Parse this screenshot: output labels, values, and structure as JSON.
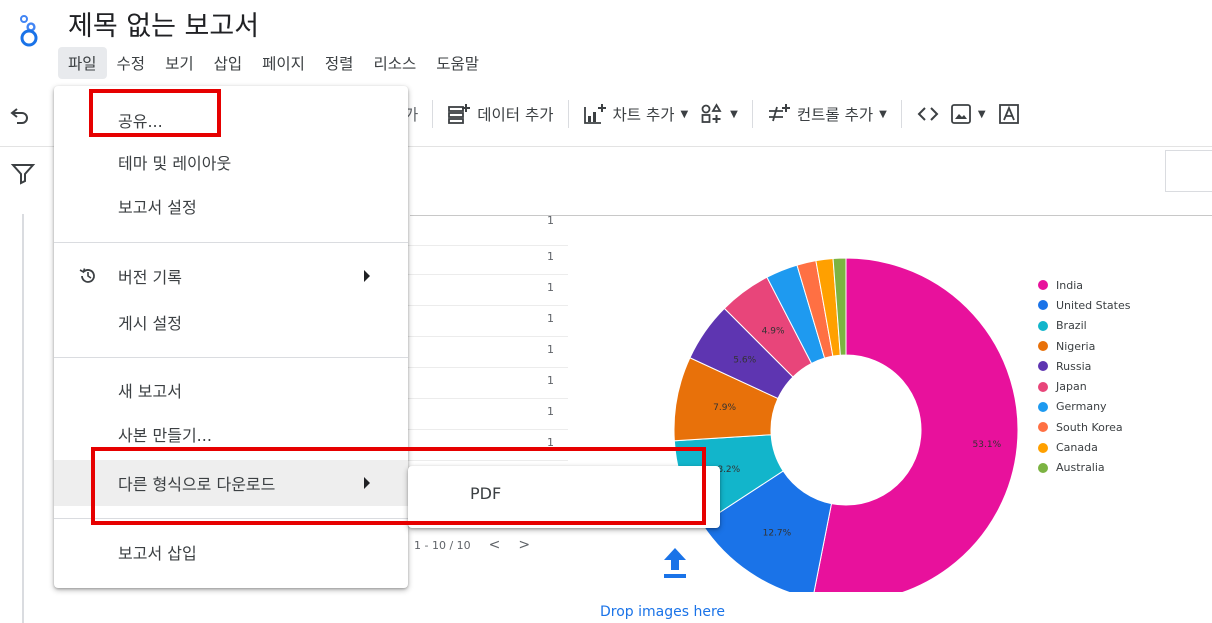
{
  "header": {
    "title": "제목 없는 보고서",
    "logo_icon": "looker-studio-logo-icon"
  },
  "menubar": [
    {
      "label": "파일",
      "active": true
    },
    {
      "label": "수정"
    },
    {
      "label": "보기"
    },
    {
      "label": "삽입"
    },
    {
      "label": "페이지"
    },
    {
      "label": "정렬"
    },
    {
      "label": "리소스"
    },
    {
      "label": "도움말"
    }
  ],
  "toolbar": {
    "partial_label": "가",
    "add_data": "데이터 추가",
    "add_chart": "차트 추가",
    "add_control": "컨트롤 추가",
    "icons": [
      "undo-icon",
      "add-data-icon",
      "add-chart-icon",
      "community-viz-icon",
      "add-control-icon",
      "code-embed-icon",
      "image-icon",
      "text-icon",
      "filter-icon"
    ]
  },
  "file_menu": {
    "items": [
      {
        "label": "공유...",
        "highlighted": true
      },
      {
        "label": "테마 및 레이아웃"
      },
      {
        "label": "보고서 설정"
      },
      {
        "label": "버전 기록",
        "icon": "history-icon",
        "submenu": true
      },
      {
        "label": "게시 설정"
      },
      {
        "label": "새 보고서"
      },
      {
        "label": "사본 만들기..."
      },
      {
        "label": "다른 형식으로 다운로드",
        "submenu": true,
        "hovered": true
      },
      {
        "label": "보고서 삽입"
      }
    ]
  },
  "download_submenu": {
    "items": [
      {
        "label": "PDF"
      }
    ]
  },
  "table": {
    "values": [
      "1",
      "1",
      "1",
      "1",
      "1",
      "1",
      "1",
      "1",
      "1"
    ],
    "pagination": "1 - 10 / 10",
    "prev": "<",
    "next": ">"
  },
  "canvas": {
    "drop_text": "Drop images here",
    "upload_icon": "upload-arrow-icon",
    "accent": "#1a73e8",
    "highlight_color": "#e60000"
  },
  "chart_data": {
    "type": "pie",
    "donut": true,
    "legend_position": "right",
    "categories": [
      "India",
      "United States",
      "Brazil",
      "Nigeria",
      "Russia",
      "Japan",
      "Germany",
      "South Korea",
      "Canada",
      "Australia"
    ],
    "values": [
      53.1,
      12.7,
      8.2,
      7.9,
      5.6,
      4.9,
      3.0,
      1.8,
      1.6,
      1.2
    ],
    "data_labels": [
      "53.1%",
      "12.7%",
      "8.2%",
      "7.9%",
      "5.6%",
      "4.9%",
      "",
      "",
      "",
      ""
    ],
    "colors": [
      "#e8119c",
      "#1a73e8",
      "#12b5cb",
      "#e8710a",
      "#5e35b1",
      "#e8457a",
      "#1e9af0",
      "#ff7043",
      "#ffa000",
      "#7cb342"
    ]
  }
}
